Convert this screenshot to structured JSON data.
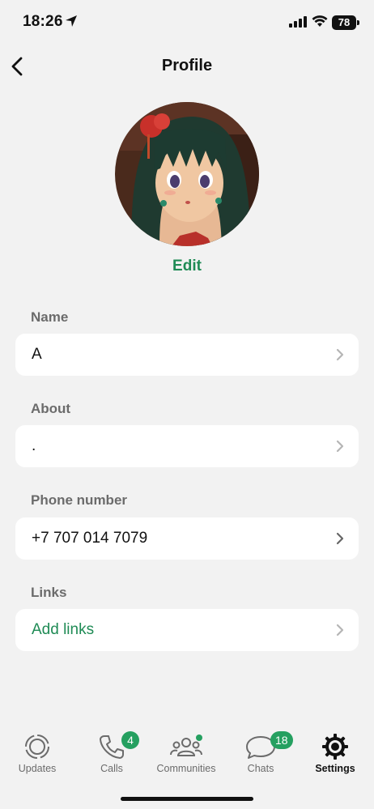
{
  "status": {
    "time": "18:26",
    "battery": "78"
  },
  "nav": {
    "title": "Profile"
  },
  "profile": {
    "edit_label": "Edit"
  },
  "fields": {
    "name": {
      "label": "Name",
      "value": "A"
    },
    "about": {
      "label": "About",
      "value": "."
    },
    "phone": {
      "label": "Phone number",
      "value": "+7 707 014 7079"
    },
    "links": {
      "label": "Links",
      "value": "Add links"
    }
  },
  "tabs": [
    {
      "label": "Updates",
      "icon": "updates-icon"
    },
    {
      "label": "Calls",
      "icon": "phone-icon",
      "badge": "4"
    },
    {
      "label": "Communities",
      "icon": "communities-icon"
    },
    {
      "label": "Chats",
      "icon": "chat-bubble-icon",
      "badge": "18"
    },
    {
      "label": "Settings",
      "icon": "gear-icon"
    }
  ],
  "colors": {
    "accent": "#1f8b55",
    "badge": "#25a060",
    "background": "#f2f2f2"
  }
}
